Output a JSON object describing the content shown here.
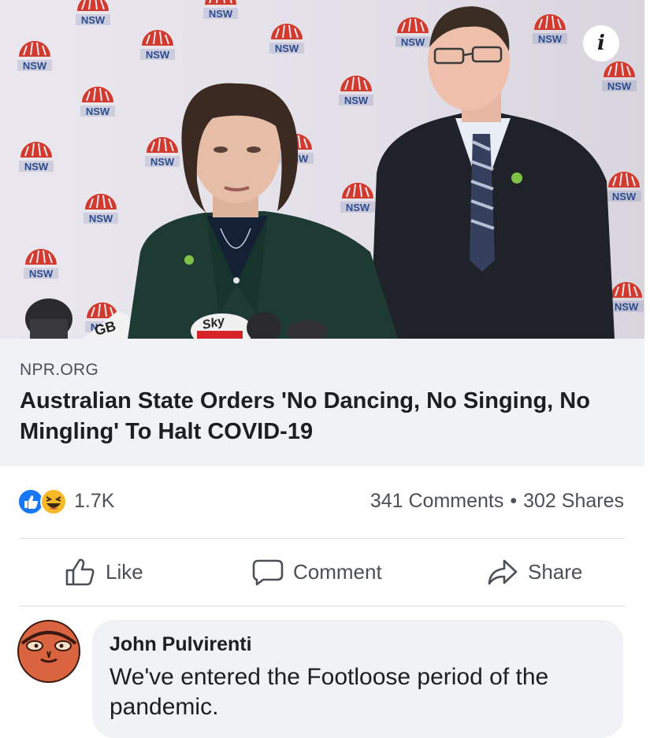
{
  "link_preview": {
    "domain": "NPR.ORG",
    "title": "Australian State Orders 'No Dancing, No Singing, No Mingling' To Halt COVID-19",
    "backdrop_logo_text": "NSW",
    "microphone_text_1": "Sky",
    "microphone_text_2": "GB",
    "info_icon": "info-icon"
  },
  "reactions": {
    "icons": [
      "like-reaction-icon",
      "haha-reaction-icon"
    ],
    "count": "1.7K",
    "comments": "341 Comments",
    "separator": "•",
    "shares": "302 Shares"
  },
  "actions": {
    "like": "Like",
    "comment": "Comment",
    "share": "Share"
  },
  "comment": {
    "author": "John Pulvirenti",
    "text": "We've entered the Footloose period of the pandemic."
  },
  "colors": {
    "facebook_blue": "#1877f2",
    "caption_background": "#f0f2f5",
    "nsw_logo_red": "#d23a2e",
    "text_primary": "#1c1e21",
    "text_secondary": "#4b4f56"
  }
}
